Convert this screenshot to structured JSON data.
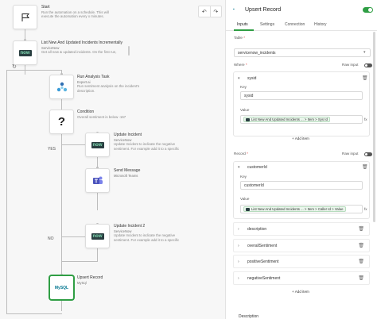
{
  "canvas": {
    "undo_icon": "undo-arrow",
    "redo_icon": "redo-arrow",
    "nodes": {
      "start": {
        "title": "Start",
        "desc1": "Run the automation on a schedule. This will",
        "desc2": "execute the automation every x minutes."
      },
      "list": {
        "title": "List New And Updated Incidents Incrementally",
        "sub": "ServiceNow",
        "desc": "Get all new & updated incidents. On the first run,"
      },
      "analysis": {
        "title": "Run Analysis Task",
        "sub": "Expert.ai",
        "desc1": "Run sentiment analysis on the incident's",
        "desc2": "description."
      },
      "condition": {
        "title": "Condition",
        "desc": "Overall sentiment is below -167",
        "glyph": "?"
      },
      "update1": {
        "title": "Update Incident",
        "sub": "ServiceNow",
        "desc1": "Update Incident to indicate the negative",
        "desc2": "sentiment. For example add it to a specific"
      },
      "send": {
        "title": "Send Message",
        "sub": "Microsoft Teams"
      },
      "update2": {
        "title": "Update Incident 2",
        "sub": "ServiceNow",
        "desc1": "Update Incident to indicate the negative",
        "desc2": "sentiment. For example add it to a specific"
      },
      "upsert": {
        "title": "Upsert Record",
        "sub": "MySql"
      }
    },
    "branches": {
      "yes": "YES",
      "no": "NO"
    },
    "logo_text": {
      "snow": "now",
      "mysql": "MySQL"
    }
  },
  "panel": {
    "icon_text": "MySQL",
    "title": "Upsert Record",
    "tabs": [
      "Inputs",
      "Settings",
      "Connection",
      "History"
    ],
    "table": {
      "label": "Table",
      "required": "*",
      "value": "servicenow_incidents"
    },
    "where": {
      "label": "Where",
      "required": "*",
      "raw_input": "Raw input",
      "item": {
        "name": "sysid",
        "key_label": "Key",
        "key_value": "sysid",
        "value_label": "Value",
        "chip": {
          "source": "List New And Updated Incidents ...",
          "sep": ">",
          "item": "Item",
          "field": "Sys Id"
        }
      },
      "add_item": "+ Add item"
    },
    "record": {
      "label": "Record",
      "required": "*",
      "raw_input": "Raw input",
      "item": {
        "name": "customerId",
        "key_label": "Key",
        "key_value": "customerId",
        "value_label": "Value",
        "chip": {
          "source": "List New And Updated Incidents ...",
          "sep": ">",
          "item": "Item",
          "field1": "Caller Id",
          "field2": "Value"
        }
      },
      "collapsed": [
        "description",
        "overallSentiment",
        "positiveSentiment",
        "negativeSentiment"
      ],
      "add_item": "+ Add item"
    },
    "description_label": "Description",
    "fx_label": "fx",
    "colors": {
      "accent": "#2f9e44",
      "snow_dark": "#293e40",
      "snow_green": "#7fd9b0"
    }
  }
}
